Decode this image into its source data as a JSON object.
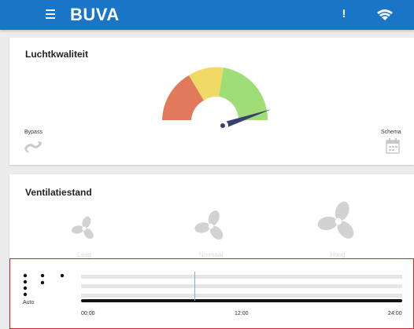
{
  "app": {
    "brand": "BUVA",
    "info_symbol": "!",
    "menu_icon": "hamburger-menu-icon",
    "status_icon": "wifi-icon"
  },
  "air_quality": {
    "title": "Luchtkwaliteit",
    "gauge_colors": {
      "bad": "#e07a5a",
      "medium": "#f0d964",
      "good": "#9fde76"
    },
    "bypass_label": "Bypass",
    "schema_label": "Schema"
  },
  "ventilation": {
    "title": "Ventilatiestand",
    "modes": [
      {
        "label": "Laag"
      },
      {
        "label": "Normaal"
      },
      {
        "label": "Hoog"
      }
    ]
  },
  "schedule": {
    "mode_label": "Auto",
    "ticks": [
      "00:00",
      "12:00",
      "24:00"
    ]
  },
  "colors": {
    "appbar": "#1975c5",
    "highlight": "#c62828"
  }
}
